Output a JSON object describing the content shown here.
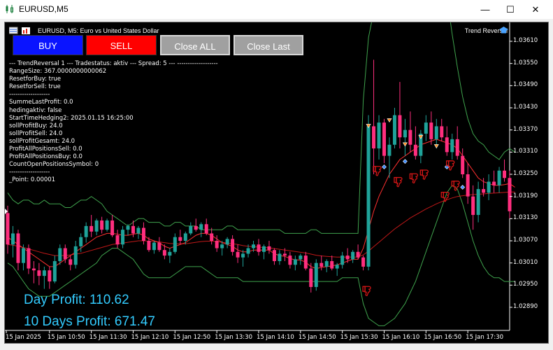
{
  "window": {
    "title": "EURUSD,M5",
    "minimize_icon": "minimize-icon",
    "maximize_icon": "maximize-icon",
    "close_icon": "close-icon"
  },
  "chart_header": {
    "symbol_line": "EURUSD, M5:  Euro vs United States Dollar",
    "indicator_name": "Trend Reversal"
  },
  "buttons": {
    "buy": "BUY",
    "sell": "SELL",
    "close_all": "Close ALL",
    "close_last": "Close Last"
  },
  "colors": {
    "buy_button": "#0a14ff",
    "sell_button": "#ff0000",
    "grey_button": "#a0a0a0",
    "bull_candle": "#1fa39a",
    "bear_candle": "#ff2e7e",
    "profit_text": "#33ccff"
  },
  "info_lines": [
    "--- TrendReversal 1 --- Tradestatus: aktiv --- Spread: 5 --- -------------------",
    "RangeSize: 367.0000000000062",
    "ResetforBuy: true",
    "ResetforSell: true",
    "-------------------",
    "SummeLastProfit: 0.0",
    "hedingaktiv: false",
    "StartTimeHedging2: 2025.01.15 16:25:00",
    "sollProfitBuy: 24.0",
    "sollProfitSell: 24.0",
    "sollProfitGesamt: 24.0",
    "ProfitAllPositionsSell: 0.0",
    "ProfitAllPositionsBuy: 0.0",
    "CountOpenPositionsSymbol: 0",
    "-------------------",
    "_Point: 0.00001"
  ],
  "profits": {
    "day": "Day Profit: 110.62",
    "ten_days": "10 Days Profit: 671.47"
  },
  "chart_data": {
    "type": "candlestick",
    "symbol": "EURUSD",
    "timeframe": "M5",
    "y_ticks": [
      "1.03610",
      "1.03550",
      "1.03490",
      "1.03430",
      "1.03370",
      "1.03310",
      "1.03250",
      "1.03190",
      "1.03130",
      "1.03070",
      "1.03010",
      "1.02950",
      "1.02890"
    ],
    "x_ticks": [
      "15 Jan 2025",
      "15 Jan 10:50",
      "15 Jan 11:30",
      "15 Jan 12:10",
      "15 Jan 12:50",
      "15 Jan 13:30",
      "15 Jan 14:10",
      "15 Jan 14:50",
      "15 Jan 15:30",
      "15 Jan 16:10",
      "15 Jan 16:50",
      "15 Jan 17:30"
    ],
    "ylim": [
      1.0285,
      1.0364
    ],
    "candles": [
      [
        1.03145,
        1.03165,
        1.03035,
        1.0306
      ],
      [
        1.0306,
        1.0311,
        1.03025,
        1.0309
      ],
      [
        1.0309,
        1.031,
        1.0299,
        1.0301
      ],
      [
        1.0301,
        1.0306,
        1.0299,
        1.0305
      ],
      [
        1.0305,
        1.0306,
        1.0298,
        1.02995
      ],
      [
        1.02995,
        1.03015,
        1.02955,
        1.0299
      ],
      [
        1.0299,
        1.0301,
        1.0295,
        1.02975
      ],
      [
        1.02975,
        1.03,
        1.0294,
        1.0299
      ],
      [
        1.0299,
        1.03,
        1.0294,
        1.0296
      ],
      [
        1.0296,
        1.0303,
        1.02955,
        1.03015
      ],
      [
        1.03015,
        1.0306,
        1.03005,
        1.0305
      ],
      [
        1.0305,
        1.0306,
        1.0301,
        1.0302
      ],
      [
        1.0302,
        1.0303,
        1.0299,
        1.03005
      ],
      [
        1.03005,
        1.0307,
        1.02995,
        1.03055
      ],
      [
        1.03055,
        1.0309,
        1.0304,
        1.0308
      ],
      [
        1.0308,
        1.0312,
        1.03065,
        1.0311
      ],
      [
        1.0311,
        1.0314,
        1.0308,
        1.03095
      ],
      [
        1.03095,
        1.0313,
        1.03085,
        1.03125
      ],
      [
        1.03125,
        1.03135,
        1.0309,
        1.031
      ],
      [
        1.031,
        1.0313,
        1.03095,
        1.03125
      ],
      [
        1.03125,
        1.0314,
        1.0308,
        1.03085
      ],
      [
        1.03085,
        1.031,
        1.0305,
        1.0306
      ],
      [
        1.0306,
        1.0311,
        1.0305,
        1.031
      ],
      [
        1.031,
        1.03115,
        1.03085,
        1.0311
      ],
      [
        1.0311,
        1.03125,
        1.0308,
        1.0309
      ],
      [
        1.0309,
        1.0311,
        1.03075,
        1.03105
      ],
      [
        1.03105,
        1.0312,
        1.0306,
        1.0307
      ],
      [
        1.0307,
        1.0308,
        1.0304,
        1.03045
      ],
      [
        1.03045,
        1.0307,
        1.03035,
        1.03065
      ],
      [
        1.03065,
        1.0308,
        1.0304,
        1.03045
      ],
      [
        1.03045,
        1.0306,
        1.0302,
        1.0303
      ],
      [
        1.0303,
        1.0305,
        1.0301,
        1.0304
      ],
      [
        1.0304,
        1.0309,
        1.03035,
        1.0308
      ],
      [
        1.0308,
        1.031,
        1.0306,
        1.0307
      ],
      [
        1.0307,
        1.03095,
        1.0306,
        1.0309
      ],
      [
        1.0309,
        1.0312,
        1.03085,
        1.0311
      ],
      [
        1.0311,
        1.0313,
        1.03095,
        1.031
      ],
      [
        1.031,
        1.0312,
        1.0308,
        1.03115
      ],
      [
        1.03115,
        1.0313,
        1.03085,
        1.0309
      ],
      [
        1.0309,
        1.03105,
        1.0306,
        1.0307
      ],
      [
        1.0307,
        1.03085,
        1.0304,
        1.0305
      ],
      [
        1.0305,
        1.0307,
        1.0303,
        1.0306
      ],
      [
        1.0306,
        1.0308,
        1.0305,
        1.03075
      ],
      [
        1.03075,
        1.03085,
        1.0303,
        1.0304
      ],
      [
        1.0304,
        1.0306,
        1.0301,
        1.03025
      ],
      [
        1.03025,
        1.03045,
        1.03,
        1.03035
      ],
      [
        1.03035,
        1.0306,
        1.03025,
        1.0305
      ],
      [
        1.0305,
        1.0307,
        1.0304,
        1.0306
      ],
      [
        1.0306,
        1.03075,
        1.0303,
        1.0304
      ],
      [
        1.0304,
        1.0306,
        1.0302,
        1.03055
      ],
      [
        1.03055,
        1.0307,
        1.03035,
        1.03045
      ],
      [
        1.03045,
        1.0305,
        1.03005,
        1.03015
      ],
      [
        1.03015,
        1.03045,
        1.03005,
        1.03035
      ],
      [
        1.03035,
        1.0305,
        1.03015,
        1.0303
      ],
      [
        1.0303,
        1.0304,
        1.02995,
        1.03005
      ],
      [
        1.03005,
        1.0303,
        1.0299,
        1.0302
      ],
      [
        1.0302,
        1.03035,
        1.03005,
        1.0303
      ],
      [
        1.0303,
        1.0304,
        1.0299,
        1.02995
      ],
      [
        1.02995,
        1.0301,
        1.0293,
        1.02945
      ],
      [
        1.02945,
        1.0302,
        1.02935,
        1.0301
      ],
      [
        1.0301,
        1.0303,
        1.0299,
        1.03
      ],
      [
        1.03,
        1.0302,
        1.02985,
        1.03015
      ],
      [
        1.03015,
        1.0303,
        1.0299,
        1.02995
      ],
      [
        1.02995,
        1.0301,
        1.02975,
        1.03005
      ],
      [
        1.03005,
        1.0304,
        1.02995,
        1.0303
      ],
      [
        1.0303,
        1.0305,
        1.0301,
        1.0302
      ],
      [
        1.0302,
        1.03045,
        1.0301,
        1.0304
      ],
      [
        1.0304,
        1.0306,
        1.0302,
        1.03025
      ],
      [
        1.03025,
        1.0303,
        1.0299,
        1.03
      ],
      [
        1.03,
        1.0341,
        1.0299,
        1.0338
      ],
      [
        1.0338,
        1.0356,
        1.0325,
        1.0332
      ],
      [
        1.0332,
        1.0341,
        1.0329,
        1.0339
      ],
      [
        1.0339,
        1.034,
        1.0328,
        1.033
      ],
      [
        1.033,
        1.0335,
        1.0324,
        1.0333
      ],
      [
        1.0333,
        1.0343,
        1.0332,
        1.0341
      ],
      [
        1.0341,
        1.035,
        1.0332,
        1.0335
      ],
      [
        1.0335,
        1.034,
        1.033,
        1.0337
      ],
      [
        1.0337,
        1.0342,
        1.0331,
        1.0333
      ],
      [
        1.0333,
        1.0338,
        1.0329,
        1.033
      ],
      [
        1.033,
        1.0337,
        1.0328,
        1.0336
      ],
      [
        1.0336,
        1.0341,
        1.0334,
        1.0339
      ],
      [
        1.0339,
        1.0342,
        1.0333,
        1.03345
      ],
      [
        1.03345,
        1.034,
        1.0332,
        1.0338
      ],
      [
        1.0338,
        1.034,
        1.0334,
        1.0335
      ],
      [
        1.0335,
        1.0338,
        1.033,
        1.0331
      ],
      [
        1.0331,
        1.0336,
        1.0329,
        1.03345
      ],
      [
        1.03345,
        1.0338,
        1.0329,
        1.033
      ],
      [
        1.033,
        1.0332,
        1.0324,
        1.0325
      ],
      [
        1.0325,
        1.0328,
        1.0317,
        1.0319
      ],
      [
        1.0319,
        1.0322,
        1.031,
        1.0314
      ],
      [
        1.0314,
        1.0323,
        1.0312,
        1.0321
      ],
      [
        1.0321,
        1.0324,
        1.0319,
        1.032
      ],
      [
        1.032,
        1.0325,
        1.0318,
        1.0323
      ],
      [
        1.0323,
        1.0326,
        1.032,
        1.0322
      ],
      [
        1.0322,
        1.0327,
        1.032,
        1.0326
      ],
      [
        1.0326,
        1.0329,
        1.0323,
        1.0324
      ],
      [
        1.0324,
        1.0326,
        1.0313,
        1.0315
      ]
    ],
    "bands_upper": [
      1.032,
      1.0318,
      1.0317,
      1.0318,
      1.0318,
      1.0317,
      1.0317,
      1.0318,
      1.0317,
      1.0317,
      1.0317,
      1.0316,
      1.0316,
      1.0317,
      1.0318,
      1.0318,
      1.0319,
      1.0318,
      1.0317,
      1.0315,
      1.0314,
      1.0313,
      1.0312,
      1.0311,
      1.0312,
      1.0313,
      1.0313,
      1.0312,
      1.0312,
      1.0312,
      1.0311,
      1.0311,
      1.0312,
      1.0312,
      1.0311,
      1.0311,
      1.0311,
      1.031,
      1.031,
      1.031,
      1.031,
      1.031,
      1.0311,
      1.0311,
      1.031,
      1.031,
      1.031,
      1.031,
      1.031,
      1.031,
      1.031,
      1.031,
      1.031,
      1.0309,
      1.0309,
      1.0309,
      1.0309,
      1.0309,
      1.031,
      1.031,
      1.0309,
      1.0309,
      1.0309,
      1.0309,
      1.0309,
      1.0309,
      1.0309,
      1.0309,
      1.0345,
      1.0362,
      1.0369,
      1.0373,
      1.0377,
      1.038,
      1.0384,
      1.0387,
      1.0389,
      1.0391,
      1.0392,
      1.0393,
      1.0392,
      1.039,
      1.0386,
      1.038,
      1.0373,
      1.0363,
      1.0354,
      1.0346,
      1.034,
      1.0336,
      1.0334,
      1.0333,
      1.0331,
      1.033,
      1.0329,
      1.0331,
      1.0332,
      1.0331
    ],
    "bands_lower": [
      1.0301,
      1.03,
      1.0298,
      1.0296,
      1.0294,
      1.0293,
      1.0292,
      1.0292,
      1.0292,
      1.0293,
      1.0294,
      1.0295,
      1.0296,
      1.0297,
      1.0298,
      1.0299,
      1.03,
      1.0301,
      1.0303,
      1.0304,
      1.0305,
      1.0305,
      1.0304,
      1.0303,
      1.0302,
      1.03,
      1.0298,
      1.0297,
      1.0297,
      1.0297,
      1.0297,
      1.0297,
      1.0298,
      1.0299,
      1.03,
      1.03,
      1.03,
      1.03,
      1.0299,
      1.0298,
      1.0297,
      1.0297,
      1.0297,
      1.0297,
      1.0297,
      1.0296,
      1.0296,
      1.0296,
      1.0296,
      1.0296,
      1.0296,
      1.0296,
      1.0296,
      1.0296,
      1.0296,
      1.0296,
      1.0296,
      1.0296,
      1.0296,
      1.0296,
      1.0296,
      1.0296,
      1.0296,
      1.0296,
      1.0297,
      1.0297,
      1.0297,
      1.0297,
      1.029,
      1.0286,
      1.0285,
      1.0284,
      1.0284,
      1.0285,
      1.0286,
      1.0288,
      1.029,
      1.0293,
      1.0296,
      1.03,
      1.0304,
      1.0308,
      1.0312,
      1.0316,
      1.032,
      1.0322,
      1.0321,
      1.0317,
      1.0312,
      1.0307,
      1.0303,
      1.03,
      1.0298,
      1.0297,
      1.0297,
      1.0296,
      1.0296,
      1.0296
    ],
    "ma_fast": [
      1.0308,
      1.0307,
      1.0306,
      1.0305,
      1.0304,
      1.0303,
      1.0302,
      1.0301,
      1.03,
      1.03,
      1.0301,
      1.0302,
      1.0303,
      1.0304,
      1.0305,
      1.0306,
      1.0307,
      1.0308,
      1.03085,
      1.0309,
      1.0309,
      1.03088,
      1.03085,
      1.03085,
      1.03088,
      1.0309,
      1.03085,
      1.03075,
      1.0307,
      1.03065,
      1.03055,
      1.0305,
      1.03055,
      1.0306,
      1.03065,
      1.03075,
      1.03085,
      1.0309,
      1.0309,
      1.03085,
      1.03075,
      1.03065,
      1.0306,
      1.03055,
      1.03045,
      1.0304,
      1.0304,
      1.03045,
      1.03045,
      1.03045,
      1.03045,
      1.03035,
      1.0303,
      1.03028,
      1.03022,
      1.03018,
      1.03018,
      1.03012,
      1.03,
      1.02995,
      1.02998,
      1.03,
      1.03002,
      1.03005,
      1.0301,
      1.03015,
      1.0302,
      1.0302,
      1.0305,
      1.031,
      1.0315,
      1.0319,
      1.0322,
      1.0325,
      1.0327,
      1.0329,
      1.033,
      1.0331,
      1.0332,
      1.0333,
      1.03335,
      1.0334,
      1.03345,
      1.0334,
      1.03335,
      1.0333,
      1.0332,
      1.033,
      1.0328,
      1.0326,
      1.0324,
      1.0323,
      1.03225,
      1.0322,
      1.0322,
      1.03222,
      1.03225,
      1.03215
    ],
    "ma_slow": [
      1.0306,
      1.03058,
      1.03055,
      1.03052,
      1.03048,
      1.03044,
      1.0304,
      1.03036,
      1.03033,
      1.0303,
      1.0303,
      1.0303,
      1.03032,
      1.03034,
      1.03036,
      1.0304,
      1.03044,
      1.03048,
      1.03052,
      1.03056,
      1.0306,
      1.03062,
      1.03064,
      1.03066,
      1.03068,
      1.0307,
      1.0307,
      1.03069,
      1.03068,
      1.03067,
      1.03065,
      1.03063,
      1.03062,
      1.03062,
      1.03062,
      1.03064,
      1.03066,
      1.03068,
      1.03069,
      1.03069,
      1.03068,
      1.03066,
      1.03064,
      1.03062,
      1.0306,
      1.03057,
      1.03055,
      1.03054,
      1.03053,
      1.03052,
      1.03051,
      1.03049,
      1.03047,
      1.03045,
      1.03043,
      1.03041,
      1.03039,
      1.03037,
      1.03034,
      1.03031,
      1.03029,
      1.03028,
      1.03027,
      1.03026,
      1.03026,
      1.03026,
      1.03026,
      1.03026,
      1.03032,
      1.03042,
      1.03054,
      1.03066,
      1.03078,
      1.0309,
      1.03102,
      1.03112,
      1.03122,
      1.03132,
      1.0314,
      1.03148,
      1.03156,
      1.03163,
      1.0317,
      1.03176,
      1.03181,
      1.03186,
      1.0319,
      1.03192,
      1.03194,
      1.03195,
      1.03196,
      1.03197,
      1.03198,
      1.03199,
      1.032,
      1.03201,
      1.03202,
      1.03202
    ]
  }
}
